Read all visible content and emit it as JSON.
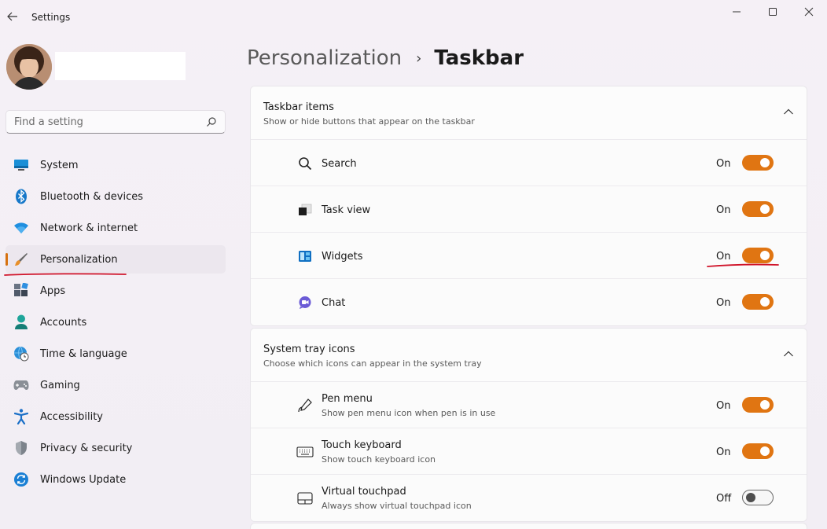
{
  "window": {
    "title": "Settings",
    "icons": {
      "back": "back-arrow-icon",
      "minimize": "minimize-icon",
      "maximize": "maximize-icon",
      "close": "close-icon"
    }
  },
  "search": {
    "placeholder": "Find a setting",
    "icon": "search-icon"
  },
  "sidebar": {
    "items": [
      {
        "label": "System",
        "icon": "monitor-icon",
        "selected": false
      },
      {
        "label": "Bluetooth & devices",
        "icon": "bluetooth-icon",
        "selected": false
      },
      {
        "label": "Network & internet",
        "icon": "wifi-icon",
        "selected": false
      },
      {
        "label": "Personalization",
        "icon": "paintbrush-icon",
        "selected": true
      },
      {
        "label": "Apps",
        "icon": "apps-icon",
        "selected": false
      },
      {
        "label": "Accounts",
        "icon": "person-icon",
        "selected": false
      },
      {
        "label": "Time & language",
        "icon": "globe-clock-icon",
        "selected": false
      },
      {
        "label": "Gaming",
        "icon": "gamepad-icon",
        "selected": false
      },
      {
        "label": "Accessibility",
        "icon": "accessibility-icon",
        "selected": false
      },
      {
        "label": "Privacy & security",
        "icon": "shield-icon",
        "selected": false
      },
      {
        "label": "Windows Update",
        "icon": "update-icon",
        "selected": false
      }
    ]
  },
  "breadcrumb": {
    "parent": "Personalization",
    "separator": "›",
    "current": "Taskbar"
  },
  "taskbar_items": {
    "title": "Taskbar items",
    "subtitle": "Show or hide buttons that appear on the taskbar",
    "rows": [
      {
        "label": "Search",
        "state": "On",
        "on": true,
        "icon": "search-icon"
      },
      {
        "label": "Task view",
        "state": "On",
        "on": true,
        "icon": "task-view-icon"
      },
      {
        "label": "Widgets",
        "state": "On",
        "on": true,
        "icon": "widgets-icon"
      },
      {
        "label": "Chat",
        "state": "On",
        "on": true,
        "icon": "chat-icon"
      }
    ]
  },
  "system_tray": {
    "title": "System tray icons",
    "subtitle": "Choose which icons can appear in the system tray",
    "rows": [
      {
        "label": "Pen menu",
        "desc": "Show pen menu icon when pen is in use",
        "state": "On",
        "on": true,
        "icon": "pen-icon"
      },
      {
        "label": "Touch keyboard",
        "desc": "Show touch keyboard icon",
        "state": "On",
        "on": true,
        "icon": "keyboard-icon"
      },
      {
        "label": "Virtual touchpad",
        "desc": "Always show virtual touchpad icon",
        "state": "Off",
        "on": false,
        "icon": "touchpad-icon"
      }
    ]
  },
  "colors": {
    "accent": "#e07512",
    "annotation": "#d0142a"
  }
}
